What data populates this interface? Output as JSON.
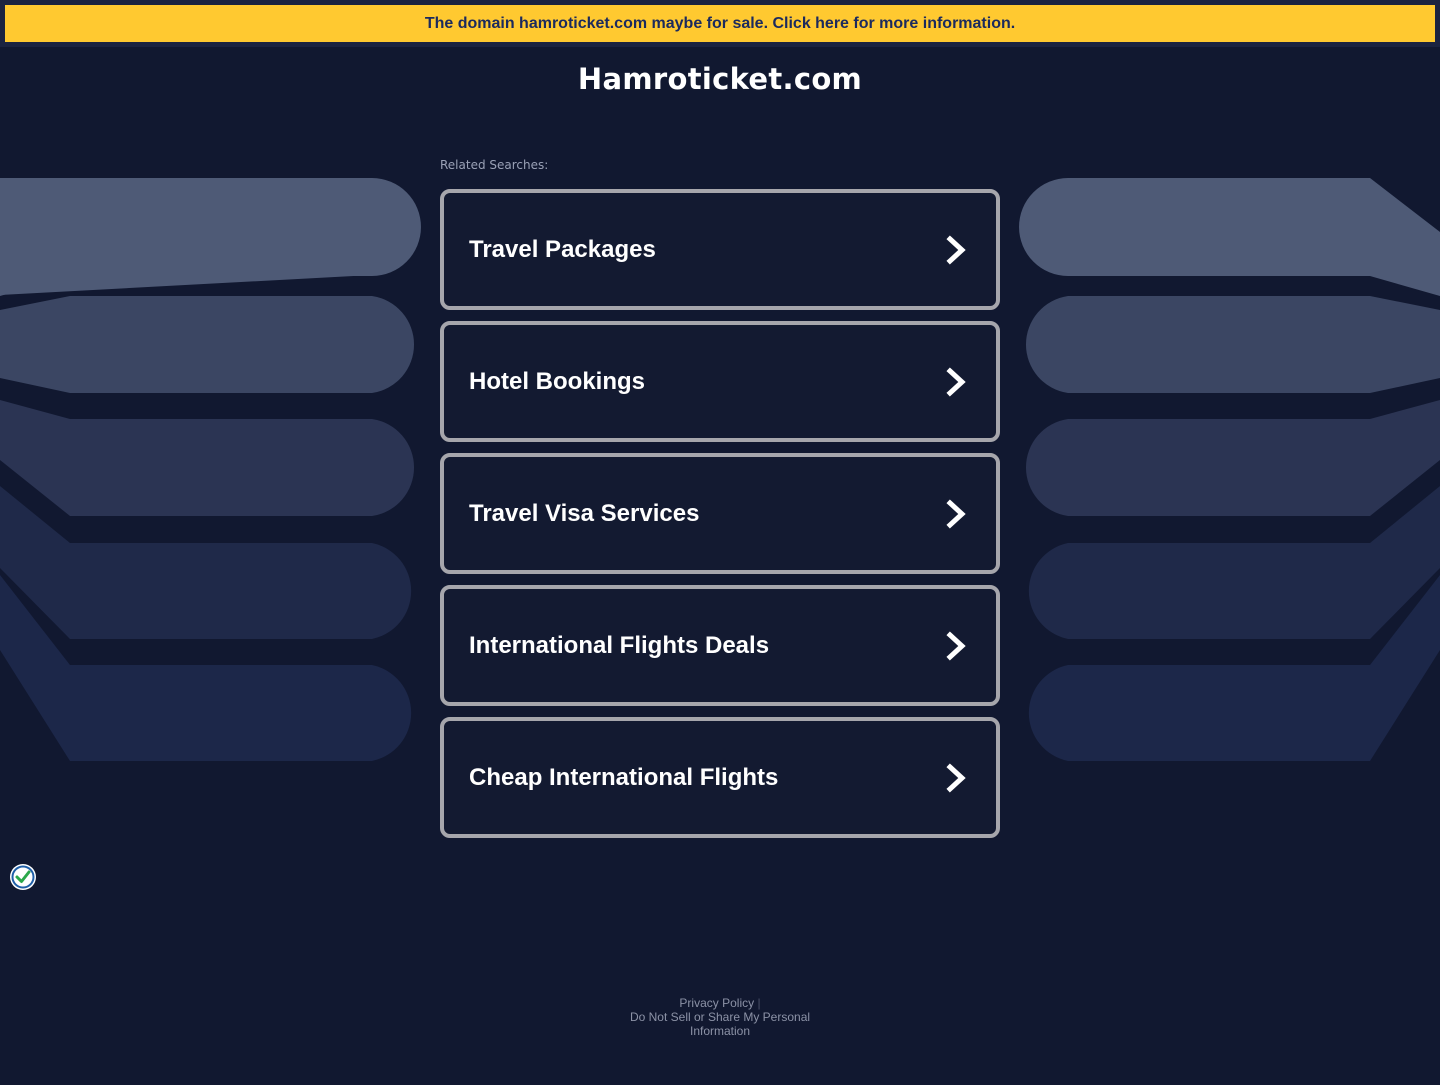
{
  "banner": {
    "text": "The domain hamroticket.com maybe for sale. Click here for more information."
  },
  "site": {
    "title": "Hamroticket.com"
  },
  "related_label": "Related Searches:",
  "links": [
    {
      "label": "Travel Packages"
    },
    {
      "label": "Hotel Bookings"
    },
    {
      "label": "Travel Visa Services"
    },
    {
      "label": "International Flights Deals"
    },
    {
      "label": "Cheap International Flights"
    }
  ],
  "footer": {
    "privacy": "Privacy Policy",
    "separator": "|",
    "do_not_sell_line1": "Do Not Sell or Share My Personal",
    "do_not_sell_line2": "Information"
  },
  "icons": {
    "chevron": "chevron-right-icon",
    "badge": "privacy-shield-check-icon"
  },
  "colors": {
    "background": "#111830",
    "banner": "#ffc930",
    "banner_text": "#1b2a5e",
    "box_border": "#a6a6ac",
    "deco_1": "#4e5a76",
    "deco_2": "#3b4663",
    "deco_3": "#2b3453",
    "deco_4": "#1f2949",
    "deco_5": "#1c2749"
  }
}
